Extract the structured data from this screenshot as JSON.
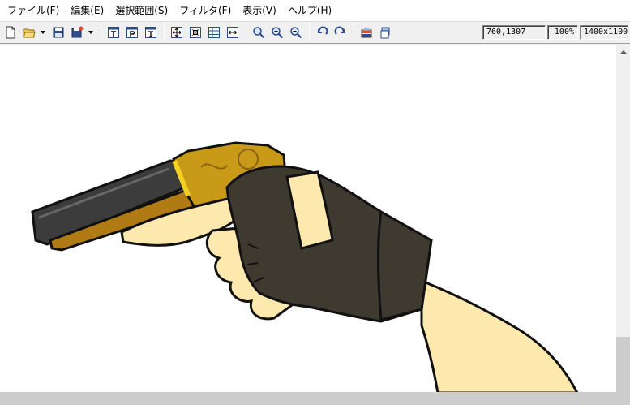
{
  "menu": {
    "items": [
      "ファイル(F)",
      "編集(E)",
      "選択範囲(S)",
      "フィルタ(F)",
      "表示(V)",
      "ヘルプ(H)"
    ]
  },
  "toolbar": {
    "buttons": [
      {
        "icon": "new-file-icon"
      },
      {
        "icon": "open-folder-icon"
      },
      {
        "icon": "save-icon"
      },
      {
        "icon": "save-as-icon"
      },
      {
        "icon": "text-tool-icon"
      },
      {
        "icon": "text-p-icon"
      },
      {
        "icon": "text-frame-icon"
      },
      {
        "icon": "move-icon"
      },
      {
        "icon": "transparent-icon"
      },
      {
        "icon": "grid-icon"
      },
      {
        "icon": "fit-width-icon"
      },
      {
        "icon": "zoom-fit-icon"
      },
      {
        "icon": "zoom-in-icon"
      },
      {
        "icon": "zoom-out-icon"
      },
      {
        "icon": "undo-icon"
      },
      {
        "icon": "redo-icon"
      },
      {
        "icon": "screenshot-icon"
      },
      {
        "icon": "layer-icon"
      }
    ]
  },
  "status": {
    "coords": "760,1307",
    "zoom": "100%",
    "size": "1400x1100"
  },
  "colors": {
    "gun_gold": "#c99a17",
    "gun_gold_light": "#f3d022",
    "barrel_dark": "#3c3c3c",
    "skin": "#fde8ad",
    "glove": "#3e3a30",
    "outline": "#111111"
  }
}
